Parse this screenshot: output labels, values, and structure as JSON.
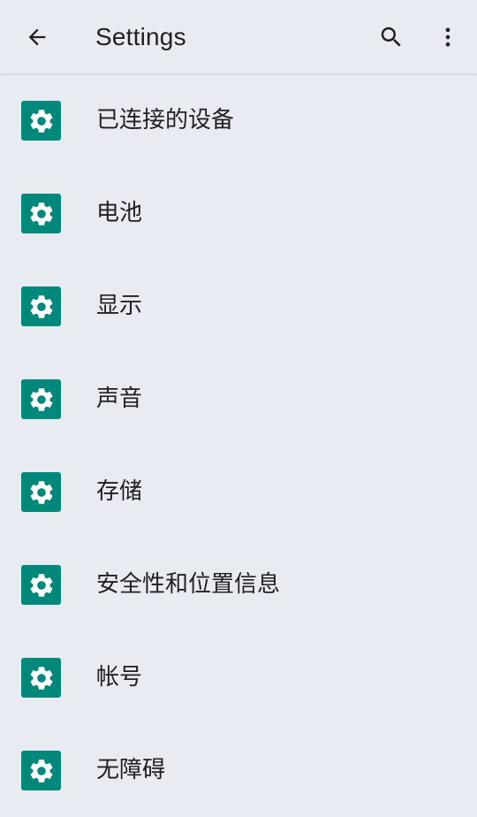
{
  "app_bar": {
    "title": "Settings",
    "back_icon": "arrow-back-icon",
    "search_icon": "search-icon",
    "more_icon": "more-vert-icon"
  },
  "settings_items": [
    {
      "label": "已连接的设备",
      "icon": "gear-icon"
    },
    {
      "label": "电池",
      "icon": "gear-icon"
    },
    {
      "label": "显示",
      "icon": "gear-icon"
    },
    {
      "label": "声音",
      "icon": "gear-icon"
    },
    {
      "label": "存储",
      "icon": "gear-icon"
    },
    {
      "label": "安全性和位置信息",
      "icon": "gear-icon"
    },
    {
      "label": "帐号",
      "icon": "gear-icon"
    },
    {
      "label": "无障碍",
      "icon": "gear-icon"
    }
  ],
  "colors": {
    "background": "#e8ebf1",
    "icon_tile": "#00897b",
    "text": "#202124"
  }
}
